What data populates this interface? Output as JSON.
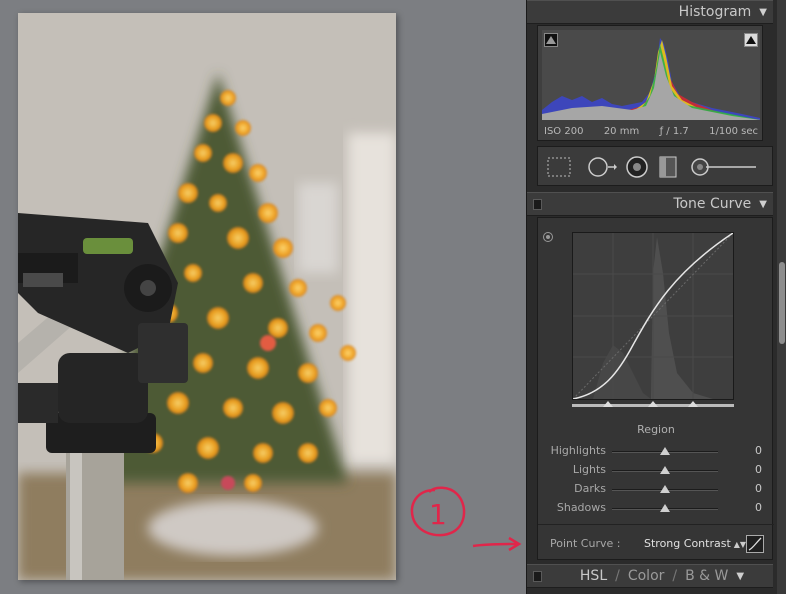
{
  "histogram": {
    "title": "Histogram",
    "iso": "ISO 200",
    "focal_length": "20 mm",
    "aperture": "ƒ / 1.7",
    "shutter": "1/100 sec"
  },
  "tone_curve": {
    "title": "Tone Curve",
    "region_title": "Region",
    "sliders": [
      {
        "label": "Highlights",
        "value": "0"
      },
      {
        "label": "Lights",
        "value": "0"
      },
      {
        "label": "Darks",
        "value": "0"
      },
      {
        "label": "Shadows",
        "value": "0"
      }
    ],
    "point_curve_label": "Point Curve :",
    "point_curve_value": "Strong Contrast"
  },
  "hsl_header": {
    "hsl": "HSL",
    "color": "Color",
    "bw": "B & W"
  },
  "annotation": {
    "number": "1",
    "color": "#e0264a"
  },
  "colors": {
    "panel_bg": "#2b2b2b",
    "header_bg": "#3b3b3b",
    "text": "#c8c8c8"
  },
  "icons": [
    "collapse-triangle-icon",
    "crop-overlay-icon",
    "spot-removal-icon",
    "red-eye-icon",
    "graduated-filter-icon",
    "adjustment-brush-icon",
    "target-adjust-icon",
    "edit-point-curve-icon",
    "panel-switch-icon"
  ]
}
